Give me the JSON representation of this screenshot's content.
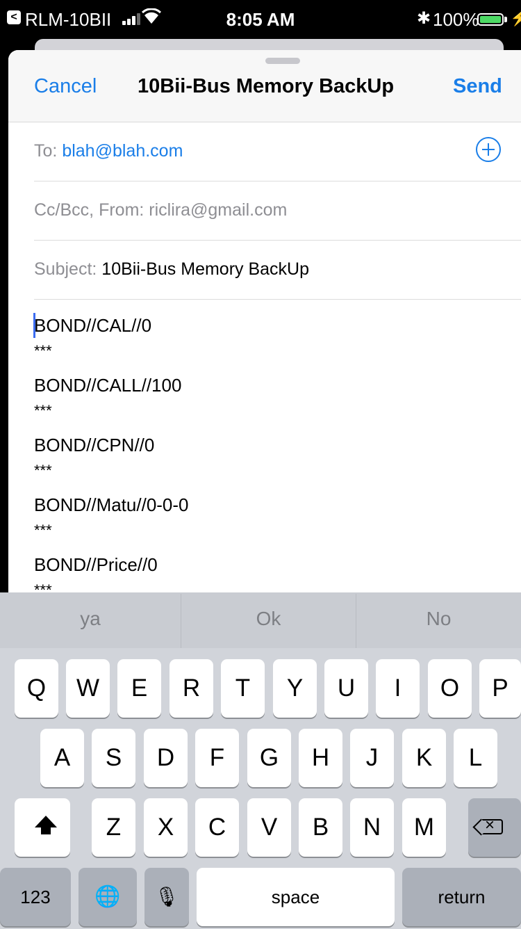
{
  "status_bar": {
    "back_glyph": "<",
    "carrier": "RLM-10BII",
    "time": "8:05 AM",
    "bluetooth_glyph": "✱",
    "battery_percent": "100%",
    "battery_level": 1.0,
    "battery_color": "#4cd964",
    "charge_glyph": "⚡"
  },
  "compose": {
    "cancel_label": "Cancel",
    "title": "10Bii-Bus Memory BackUp",
    "send_label": "Send",
    "to_label": "To:",
    "to_value": "blah@blah.com",
    "add_icon": "plus-circle-icon",
    "cc_label": "Cc/Bcc, From:",
    "cc_value": "riclira@gmail.com",
    "subject_label": "Subject:",
    "subject_value": "10Bii-Bus Memory BackUp",
    "body_lines": [
      "BOND//CAL//0",
      "***",
      "BOND//CALL//100",
      "***",
      "BOND//CPN//0",
      "***",
      "BOND//Matu//0-0-0",
      "***",
      "BOND//Price//0",
      "***"
    ],
    "accent_color": "#1a7ee8"
  },
  "keyboard": {
    "predictions": [
      "ya",
      "Ok",
      "No"
    ],
    "row1": [
      "Q",
      "W",
      "E",
      "R",
      "T",
      "Y",
      "U",
      "I",
      "O",
      "P"
    ],
    "row2": [
      "A",
      "S",
      "D",
      "F",
      "G",
      "H",
      "J",
      "K",
      "L"
    ],
    "row3": [
      "Z",
      "X",
      "C",
      "V",
      "B",
      "N",
      "M"
    ],
    "shift_icon": "shift-icon",
    "delete_icon": "delete-icon",
    "numbers_label": "123",
    "globe_glyph": "🌐",
    "mic_glyph": "🎙",
    "space_label": "space",
    "return_label": "return"
  }
}
